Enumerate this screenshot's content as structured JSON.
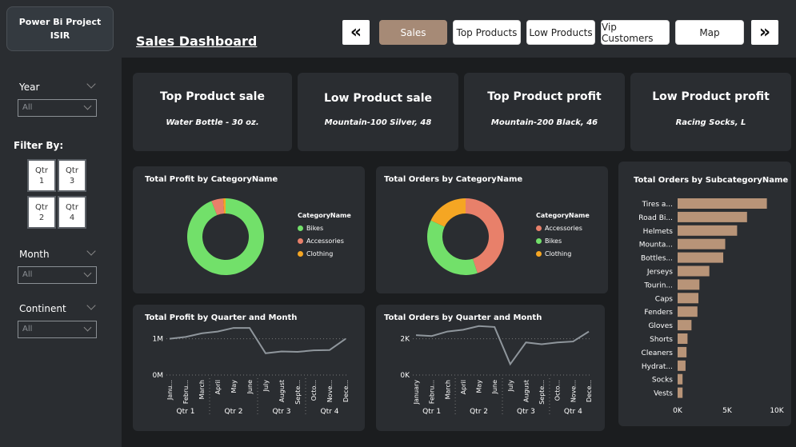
{
  "sidebar": {
    "project_title_line1": "Power Bi Project",
    "project_title_line2": "ISIR",
    "year_label": "Year",
    "year_value": "All",
    "filter_label": "Filter By:",
    "quarters": [
      {
        "line1": "Qtr",
        "line2": "1"
      },
      {
        "line1": "Qtr",
        "line2": "3"
      },
      {
        "line1": "Qtr",
        "line2": "2"
      },
      {
        "line1": "Qtr",
        "line2": "4"
      }
    ],
    "month_label": "Month",
    "month_value": "All",
    "continent_label": "Continent",
    "continent_value": "All"
  },
  "header": {
    "title": "Sales Dashboard",
    "prev_icon": "«",
    "next_icon": "»",
    "nav": [
      "Sales",
      "Top Products",
      "Low Products",
      "Vip Customers",
      "Map"
    ],
    "active_nav": "Sales"
  },
  "kpis": [
    {
      "title": "Top Product sale",
      "value": "Water Bottle - 30 oz."
    },
    {
      "title": "Low Product sale",
      "value": "Mountain-100 Silver, 48"
    },
    {
      "title": "Top Product profit",
      "value": "Mountain-200 Black, 46"
    },
    {
      "title": "Low Product profit",
      "value": "Racing Socks, L"
    }
  ],
  "colors": {
    "bikes": "#72e06a",
    "accessories": "#e8806a",
    "clothing": "#f5a623",
    "bar": "#b89478",
    "line": "#8f969c"
  },
  "chart_data": [
    {
      "type": "pie",
      "title": "Total Profit by CategoryName",
      "legend_title": "CategoryName",
      "labels": [
        "Bikes",
        "Accessories",
        "Clothing"
      ],
      "values": [
        94,
        5,
        1
      ]
    },
    {
      "type": "pie",
      "title": "Total Orders by CategoryName",
      "legend_title": "CategoryName",
      "labels": [
        "Accessories",
        "Bikes",
        "Clothing"
      ],
      "values": [
        45,
        37,
        18
      ]
    },
    {
      "type": "bar",
      "orientation": "horizontal",
      "title": "Total Orders by SubcategoryName",
      "categories": [
        "Tires a...",
        "Road Bi...",
        "Helmets",
        "Mounta...",
        "Bottles...",
        "Jerseys",
        "Tourin...",
        "Caps",
        "Fenders",
        "Gloves",
        "Shorts",
        "Cleaners",
        "Hydrat...",
        "Socks",
        "Vests"
      ],
      "values": [
        9000,
        7000,
        6000,
        4800,
        4600,
        3200,
        2200,
        2100,
        2000,
        1400,
        1000,
        900,
        800,
        500,
        500
      ],
      "xticks": [
        "0K",
        "5K",
        "10K"
      ],
      "xlim": [
        0,
        10000
      ]
    },
    {
      "type": "line",
      "title": "Total Profit by Quarter and Month",
      "x": [
        "Janu...",
        "Febru...",
        "March",
        "April",
        "May",
        "June",
        "July",
        "August",
        "Septe...",
        "Octo...",
        "Nove...",
        "Dece..."
      ],
      "groups": [
        "Qtr 1",
        "Qtr 2",
        "Qtr 3",
        "Qtr 4"
      ],
      "values": [
        1000000,
        1050000,
        1150000,
        1200000,
        1300000,
        1300000,
        600000,
        650000,
        640000,
        680000,
        690000,
        1000000
      ],
      "yticks": [
        "0M",
        "1M"
      ],
      "ylim": [
        0,
        1500000
      ]
    },
    {
      "type": "line",
      "title": "Total Orders by Quarter and Month",
      "x": [
        "January",
        "Febru...",
        "March",
        "April",
        "May",
        "June",
        "July",
        "August",
        "Septe...",
        "Octo...",
        "Nove...",
        "Dece..."
      ],
      "groups": [
        "Qtr 1",
        "Qtr 2",
        "Qtr 3",
        "Qtr 4"
      ],
      "values": [
        2200,
        2150,
        2400,
        2500,
        2700,
        2650,
        600,
        1800,
        1700,
        1800,
        1850,
        2400
      ],
      "yticks": [
        "0K",
        "2K"
      ],
      "ylim": [
        0,
        3000
      ]
    }
  ]
}
